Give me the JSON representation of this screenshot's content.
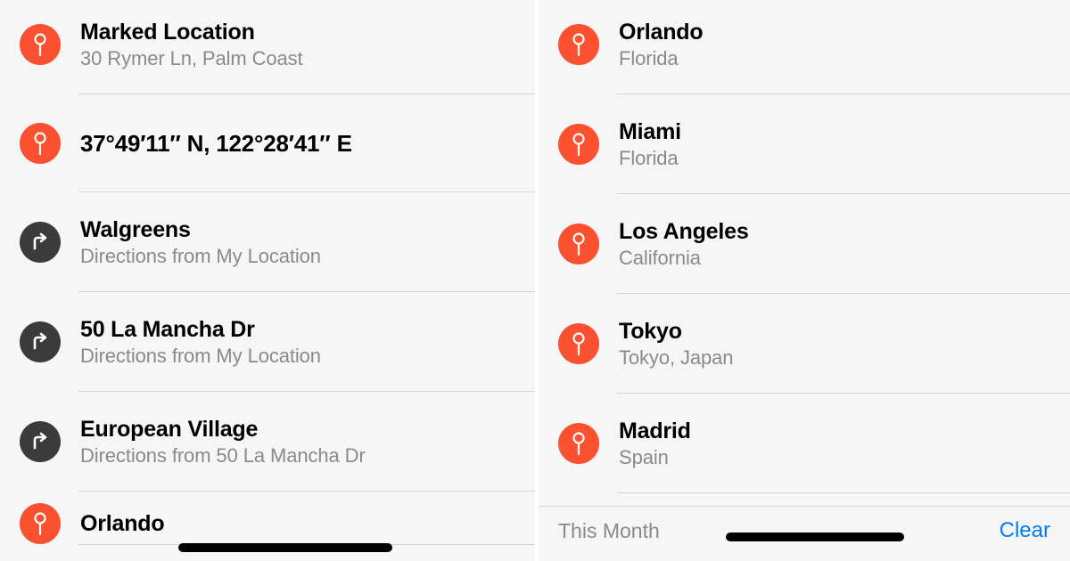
{
  "left": {
    "items": [
      {
        "icon": "pin",
        "title": "Marked Location",
        "subtitle": "30 Rymer Ln, Palm Coast"
      },
      {
        "icon": "pin",
        "title": "37°49′11″ N, 122°28′41″ E",
        "subtitle": ""
      },
      {
        "icon": "dir",
        "title": "Walgreens",
        "subtitle": "Directions from My Location"
      },
      {
        "icon": "dir",
        "title": "50 La Mancha Dr",
        "subtitle": "Directions from My Location"
      },
      {
        "icon": "dir",
        "title": "European Village",
        "subtitle": "Directions from 50 La Mancha Dr"
      },
      {
        "icon": "pin",
        "title": "Orlando",
        "subtitle": ""
      }
    ]
  },
  "right": {
    "items": [
      {
        "icon": "pin",
        "title": "Orlando",
        "subtitle": "Florida"
      },
      {
        "icon": "pin",
        "title": "Miami",
        "subtitle": "Florida"
      },
      {
        "icon": "pin",
        "title": "Los Angeles",
        "subtitle": "California"
      },
      {
        "icon": "pin",
        "title": "Tokyo",
        "subtitle": "Tokyo, Japan"
      },
      {
        "icon": "pin",
        "title": "Madrid",
        "subtitle": "Spain"
      }
    ],
    "footer": {
      "section": "This Month",
      "clear": "Clear"
    }
  }
}
